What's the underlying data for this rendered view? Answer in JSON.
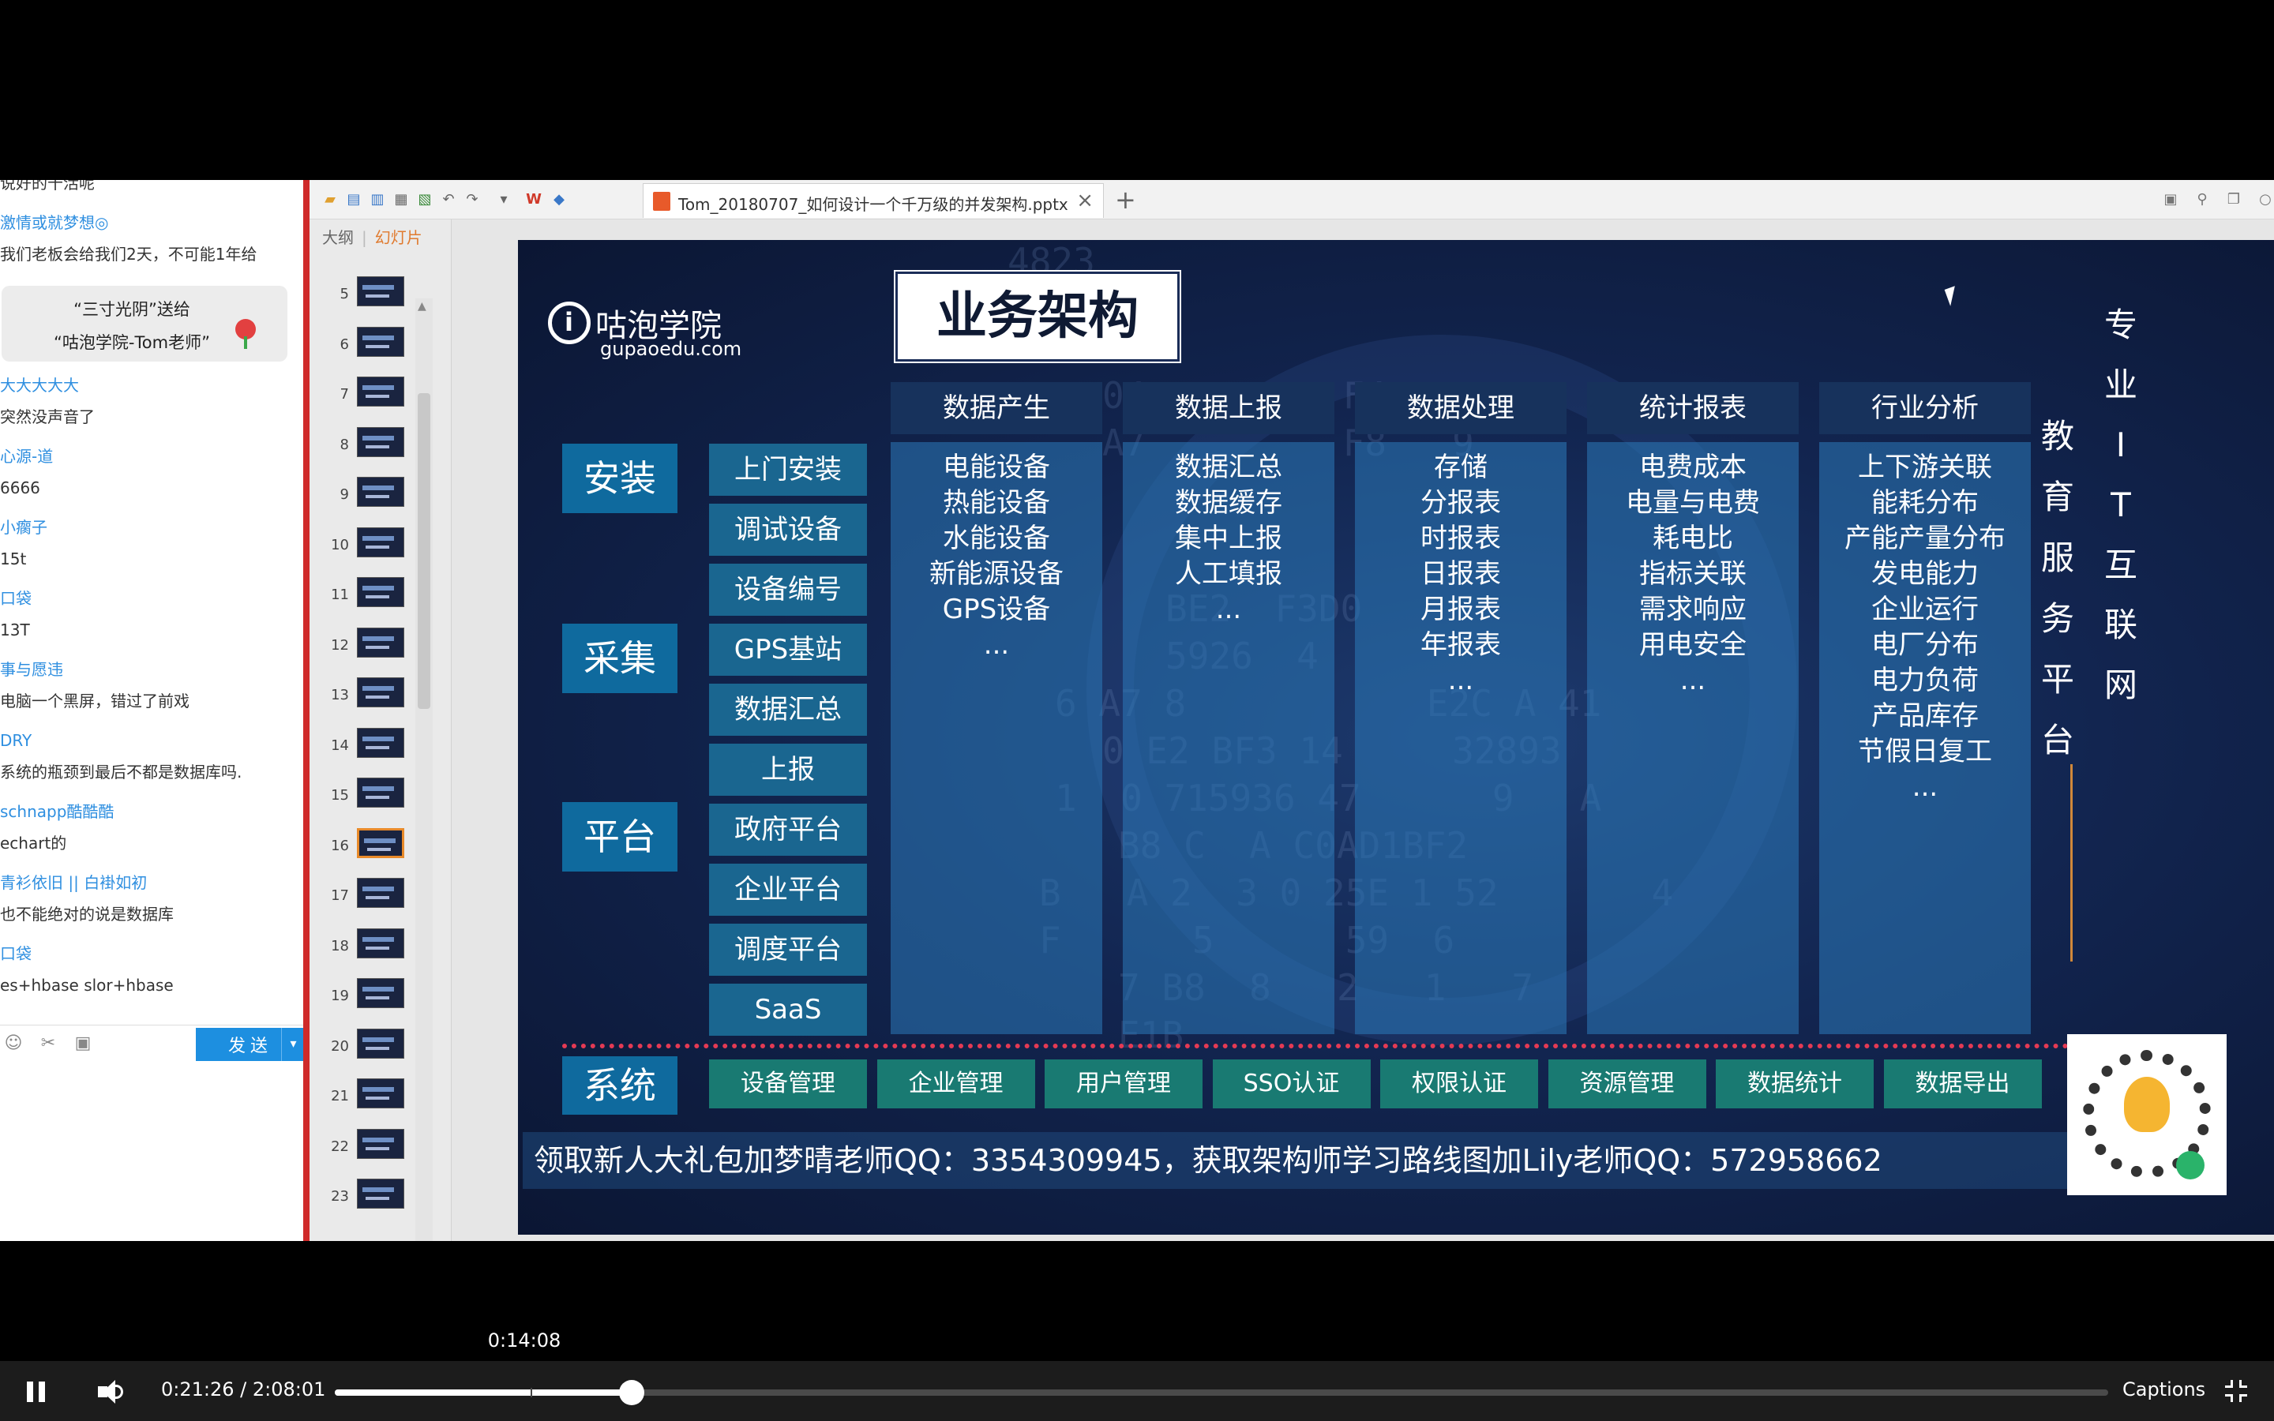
{
  "chat": {
    "messages": [
      {
        "name": "",
        "text": "说好的十活呢"
      },
      {
        "name": "激情或就梦想◎",
        "text": "我们老板会给我们2天，不可能1年给"
      },
      {
        "gift": true,
        "line1": "“三寸光阴”送给",
        "line2": "“咕泡学院-Tom老师”"
      },
      {
        "name": "大大大大大",
        "text": "突然没声音了"
      },
      {
        "name": "心源-道",
        "text": "6666"
      },
      {
        "name": "小瘸子",
        "text": "15t"
      },
      {
        "name": "口袋",
        "text": "13T"
      },
      {
        "name": "事与愿违",
        "text": "电脑一个黑屏，错过了前戏"
      },
      {
        "name": "DRY",
        "text": "系统的瓶颈到最后不都是数据库吗."
      },
      {
        "name": "schnapp酷酷酷",
        "text": "echart的"
      },
      {
        "name": "青衫依旧 || 白褂如初",
        "text": "也不能绝对的说是数据库"
      },
      {
        "name": "口袋",
        "text": "es+hbase slor+hbase"
      }
    ],
    "send_label": "发送",
    "send_arrow": "▾"
  },
  "app": {
    "file_tab": "Tom_20180707_如何设计一个千万级的并发架构.pptx",
    "close": "×",
    "add_tab": "+",
    "outline_tab": "大纲",
    "slides_tab": "幻灯片",
    "slide_numbers": [
      "5",
      "6",
      "7",
      "8",
      "9",
      "10",
      "11",
      "12",
      "13",
      "14",
      "15",
      "16",
      "17",
      "18",
      "19",
      "20",
      "21",
      "22",
      "23"
    ],
    "selected_slide": "16"
  },
  "slide": {
    "logo_name": "咕泡学院",
    "logo_site": "gupaoedu.com",
    "title": "业务架构",
    "left_categories": [
      "安装",
      "采集",
      "平台"
    ],
    "sub_items": [
      "上门安装",
      "调试设备",
      "设备编号",
      "GPS基站",
      "数据汇总",
      "上报",
      "政府平台",
      "企业平台",
      "调度平台",
      "SaaS"
    ],
    "columns": [
      {
        "head": "数据产生",
        "items": [
          "电能设备",
          "热能设备",
          "水能设备",
          "新能源设备",
          "GPS设备",
          "..."
        ]
      },
      {
        "head": "数据上报",
        "items": [
          "数据汇总",
          "数据缓存",
          "集中上报",
          "人工填报",
          "..."
        ]
      },
      {
        "head": "数据处理",
        "items": [
          "存储",
          "分报表",
          "时报表",
          "日报表",
          "月报表",
          "年报表",
          "..."
        ]
      },
      {
        "head": "统计报表",
        "items": [
          "电费成本",
          "电量与电费",
          "耗电比",
          "指标关联",
          "需求响应",
          "用电安全",
          "..."
        ]
      },
      {
        "head": "行业分析",
        "items": [
          "上下游关联",
          "能耗分布",
          "产能产量分布",
          "发电能力",
          "企业运行",
          "电厂分布",
          "电力负荷",
          "产品库存",
          "节假日复工",
          "..."
        ]
      }
    ],
    "system_label": "系统",
    "system_items": [
      "设备管理",
      "企业管理",
      "用户管理",
      "SSO认证",
      "权限认证",
      "资源管理",
      "数据统计",
      "数据导出"
    ],
    "banner": "领取新人大礼包加梦晴老师QQ：3354309945，获取架构师学习路线图加Lily老师QQ：572958662",
    "vertical_right": [
      "专",
      "业",
      "I",
      "T",
      "互",
      "联",
      "网"
    ],
    "vertical_left": [
      "教",
      "育",
      "服",
      "务",
      "平",
      "台"
    ]
  },
  "player": {
    "hover_time": "0:14:08",
    "current_time": "0:21:26",
    "separator": "/",
    "duration": "2:08:01",
    "progress": 0.1675,
    "captions_label": "Captions"
  }
}
